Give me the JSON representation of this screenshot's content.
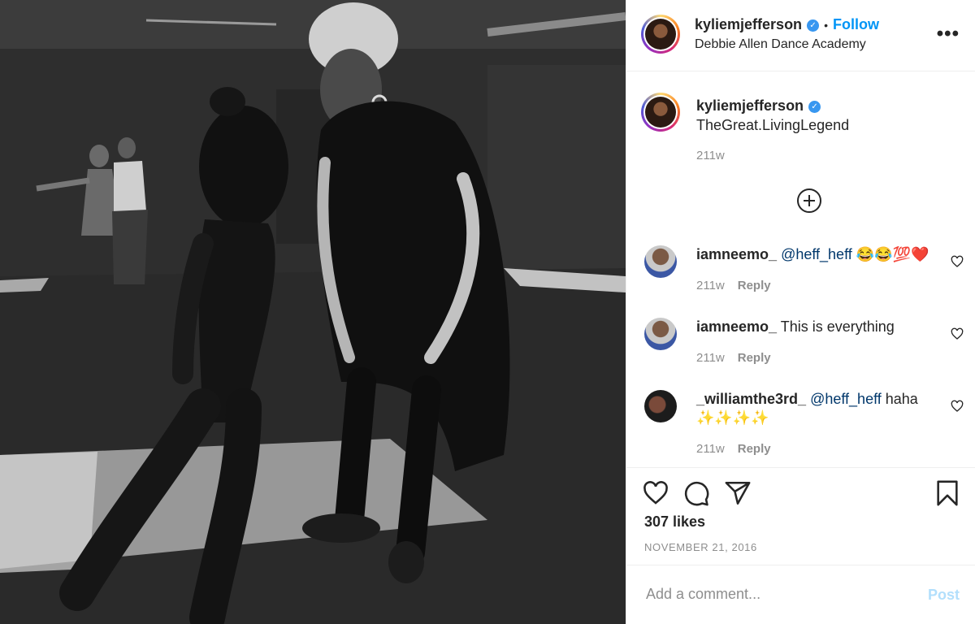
{
  "header": {
    "username": "kyliemjefferson",
    "verified_mark": "✓",
    "separator": "•",
    "follow_label": "Follow",
    "location": "Debbie Allen Dance Academy",
    "more_label": "•••"
  },
  "caption": {
    "username": "kyliemjefferson",
    "text": "TheGreat.LivingLegend",
    "time": "211w"
  },
  "comments": [
    {
      "username": "iamneemo_",
      "mention": "@heff_heff",
      "text": " 😂😂💯❤️",
      "time": "211w",
      "reply_label": "Reply"
    },
    {
      "username": "iamneemo_",
      "mention": "",
      "text": "This is everything",
      "time": "211w",
      "reply_label": "Reply"
    },
    {
      "username": "_williamthe3rd_",
      "mention": "@heff_heff",
      "text": " haha ✨✨✨✨",
      "time": "211w",
      "reply_label": "Reply"
    }
  ],
  "actions": {
    "likes": "307 likes",
    "date": "NOVEMBER 21, 2016",
    "icons": [
      "heart-icon",
      "comment-icon",
      "share-icon",
      "bookmark-icon"
    ]
  },
  "add_comment": {
    "placeholder": "Add a comment...",
    "post_label": "Post"
  },
  "colors": {
    "accent": "#0095f6",
    "post_disabled": "#b2dffc",
    "muted": "#8e8e8e",
    "verified": "#3897f0"
  }
}
